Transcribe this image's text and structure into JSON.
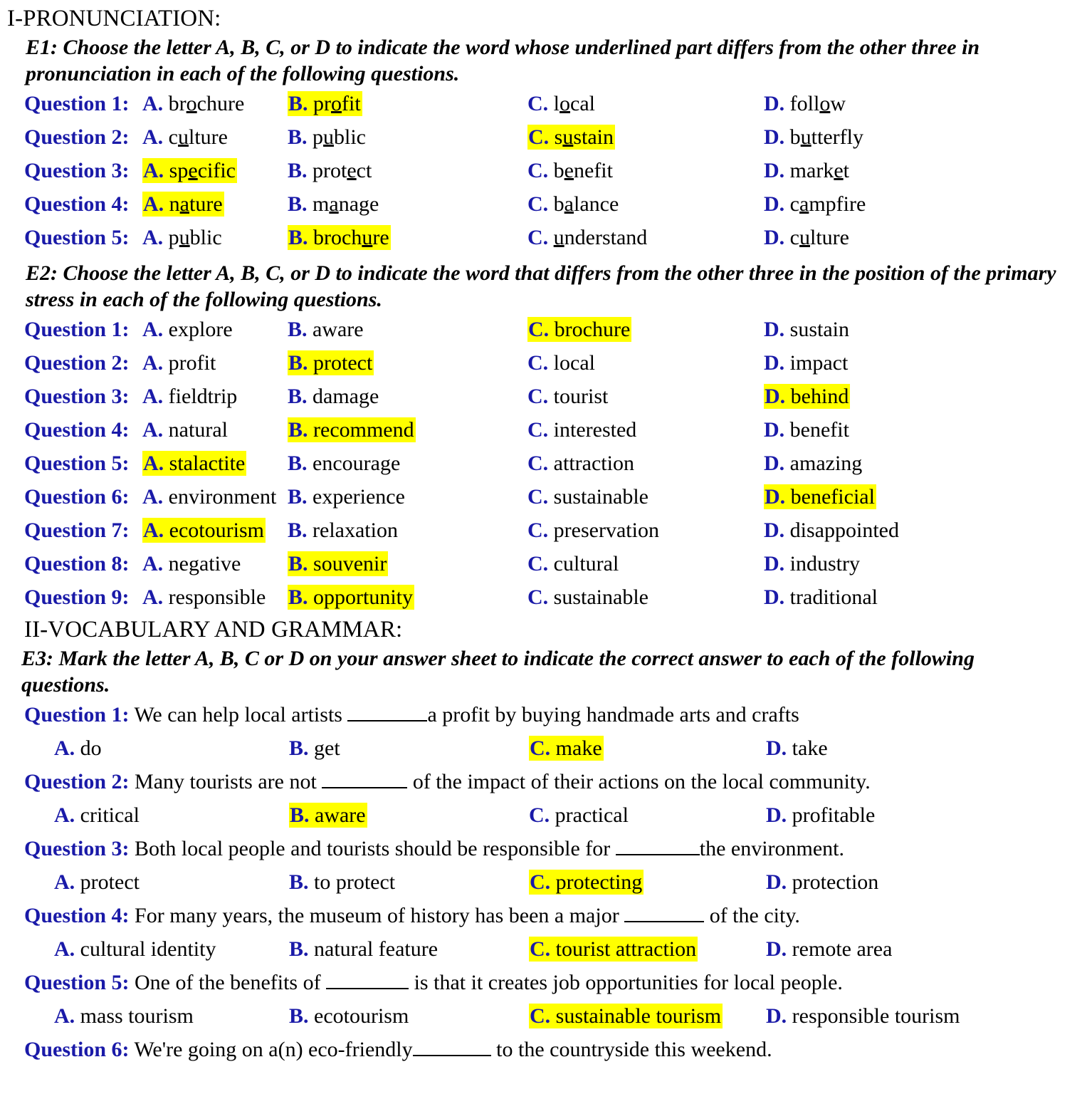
{
  "colors": {
    "blue": "#1a1aa8",
    "highlight": "#ffff00",
    "text": "#000000",
    "page_background": "#ffffff"
  },
  "sections": {
    "s1_heading": "I-PRONUNCIATION:",
    "s2_heading": "II-VOCABULARY AND GRAMMAR:"
  },
  "e1": {
    "instruction": "E1: Choose the letter A, B, C, or D to indicate the word whose underlined part differs from the other three in pronunciation in each of the following questions.",
    "questions": [
      {
        "label": "Question 1:",
        "options": [
          {
            "letter": "A.",
            "pre": "br",
            "mid": "o",
            "post": "chure",
            "highlight": false
          },
          {
            "letter": "B.",
            "pre": "pr",
            "mid": "o",
            "post": "fit",
            "highlight": true
          },
          {
            "letter": "C.",
            "pre": "l",
            "mid": "o",
            "post": "cal",
            "highlight": false
          },
          {
            "letter": "D.",
            "pre": "foll",
            "mid": "o",
            "post": "w",
            "highlight": false
          }
        ]
      },
      {
        "label": "Question 2:",
        "options": [
          {
            "letter": "A.",
            "pre": "c",
            "mid": "u",
            "post": "lture",
            "highlight": false
          },
          {
            "letter": "B.",
            "pre": "p",
            "mid": "u",
            "post": "blic",
            "highlight": false
          },
          {
            "letter": "C.",
            "pre": "s",
            "mid": "u",
            "post": "stain",
            "highlight": true
          },
          {
            "letter": "D.",
            "pre": "b",
            "mid": "u",
            "post": "tterfly",
            "highlight": false
          }
        ]
      },
      {
        "label": "Question 3:",
        "options": [
          {
            "letter": "A.",
            "pre": "sp",
            "mid": "e",
            "post": "cific",
            "highlight": true
          },
          {
            "letter": "B.",
            "pre": "prot",
            "mid": "e",
            "post": "ct",
            "highlight": false
          },
          {
            "letter": "C.",
            "pre": "b",
            "mid": "e",
            "post": "nefit",
            "highlight": false
          },
          {
            "letter": "D.",
            "pre": "mark",
            "mid": "e",
            "post": "t",
            "highlight": false
          }
        ]
      },
      {
        "label": "Question 4:",
        "options": [
          {
            "letter": "A.",
            "pre": "n",
            "mid": "a",
            "post": "ture",
            "highlight": true
          },
          {
            "letter": "B.",
            "pre": "m",
            "mid": "a",
            "post": "nage",
            "highlight": false
          },
          {
            "letter": "C.",
            "pre": "b",
            "mid": "a",
            "post": "lance",
            "highlight": false
          },
          {
            "letter": "D.",
            "pre": "c",
            "mid": "a",
            "post": "mpfire",
            "highlight": false
          }
        ]
      },
      {
        "label": "Question 5:",
        "options": [
          {
            "letter": "A.",
            "pre": "p",
            "mid": "u",
            "post": "blic",
            "highlight": false
          },
          {
            "letter": "B.",
            "pre": "broch",
            "mid": "u",
            "post": "re",
            "highlight": true
          },
          {
            "letter": "C.",
            "pre": "",
            "mid": "u",
            "post": "nderstand",
            "highlight": false
          },
          {
            "letter": "D.",
            "pre": "c",
            "mid": "u",
            "post": "lture",
            "highlight": false
          }
        ]
      }
    ]
  },
  "e2": {
    "instruction": "E2: Choose the letter A, B, C, or D to indicate the word that differs from the other three in the position of the primary stress in each of the following questions.",
    "questions": [
      {
        "label": "Question 1:",
        "options": [
          {
            "letter": "A.",
            "word": "explore",
            "highlight": false
          },
          {
            "letter": "B.",
            "word": "aware",
            "highlight": false
          },
          {
            "letter": "C.",
            "word": "brochure",
            "highlight": true
          },
          {
            "letter": "D.",
            "word": "sustain",
            "highlight": false
          }
        ]
      },
      {
        "label": "Question 2:",
        "options": [
          {
            "letter": "A.",
            "word": "profit",
            "highlight": false
          },
          {
            "letter": "B.",
            "word": "protect",
            "highlight": true
          },
          {
            "letter": "C.",
            "word": "local",
            "highlight": false
          },
          {
            "letter": "D.",
            "word": "impact",
            "highlight": false
          }
        ]
      },
      {
        "label": "Question 3:",
        "options": [
          {
            "letter": "A.",
            "word": "fieldtrip",
            "highlight": false
          },
          {
            "letter": "B.",
            "word": "damage",
            "highlight": false
          },
          {
            "letter": "C.",
            "word": "tourist",
            "highlight": false
          },
          {
            "letter": "D.",
            "word": "behind",
            "highlight": true
          }
        ]
      },
      {
        "label": "Question 4:",
        "options": [
          {
            "letter": "A.",
            "word": "natural",
            "highlight": false
          },
          {
            "letter": "B.",
            "word": "recommend",
            "highlight": true
          },
          {
            "letter": "C.",
            "word": "interested",
            "highlight": false
          },
          {
            "letter": "D.",
            "word": "benefit",
            "highlight": false
          }
        ]
      },
      {
        "label": "Question 5:",
        "options": [
          {
            "letter": "A.",
            "word": "stalactite",
            "highlight": true
          },
          {
            "letter": "B.",
            "word": "encourage",
            "highlight": false
          },
          {
            "letter": "C.",
            "word": "attraction",
            "highlight": false
          },
          {
            "letter": "D.",
            "word": "amazing",
            "highlight": false
          }
        ]
      },
      {
        "label": "Question 6:",
        "options": [
          {
            "letter": "A.",
            "word": "environment",
            "highlight": false
          },
          {
            "letter": "B.",
            "word": "experience",
            "highlight": false
          },
          {
            "letter": "C.",
            "word": "sustainable",
            "highlight": false
          },
          {
            "letter": "D.",
            "word": "beneficial",
            "highlight": true
          }
        ]
      },
      {
        "label": "Question 7:",
        "options": [
          {
            "letter": "A.",
            "word": "ecotourism",
            "highlight": true
          },
          {
            "letter": "B.",
            "word": "relaxation",
            "highlight": false
          },
          {
            "letter": "C.",
            "word": "preservation",
            "highlight": false
          },
          {
            "letter": "D.",
            "word": "disappointed",
            "highlight": false
          }
        ]
      },
      {
        "label": "Question 8:",
        "options": [
          {
            "letter": "A.",
            "word": "negative",
            "highlight": false
          },
          {
            "letter": "B.",
            "word": "souvenir",
            "highlight": true
          },
          {
            "letter": "C.",
            "word": "cultural",
            "highlight": false
          },
          {
            "letter": "D.",
            "word": "industry",
            "highlight": false
          }
        ]
      },
      {
        "label": "Question 9:",
        "options": [
          {
            "letter": "A.",
            "word": "responsible",
            "highlight": false
          },
          {
            "letter": "B.",
            "word": "opportunity",
            "highlight": true
          },
          {
            "letter": "C.",
            "word": "sustainable",
            "highlight": false
          },
          {
            "letter": "D.",
            "word": "traditional",
            "highlight": false
          }
        ]
      }
    ]
  },
  "e3": {
    "instruction": "E3: Mark the letter A, B, C or D on your answer sheet to indicate the correct answer to each of the following questions.",
    "questions": [
      {
        "label": "Question 1:",
        "stem_before": "We can help local artists",
        "stem_after": "a profit by buying handmade arts and crafts",
        "options": [
          {
            "letter": "A.",
            "text": "do",
            "highlight": false
          },
          {
            "letter": "B.",
            "text": "get",
            "highlight": false
          },
          {
            "letter": "C.",
            "text": "make",
            "highlight": true
          },
          {
            "letter": "D.",
            "text": "take",
            "highlight": false
          }
        ]
      },
      {
        "label": "Question 2:",
        "stem_before": "Many tourists are not",
        "stem_after": "of the impact of their actions on the local community.",
        "options": [
          {
            "letter": "A.",
            "text": "critical",
            "highlight": false
          },
          {
            "letter": "B.",
            "text": "aware",
            "highlight": true
          },
          {
            "letter": "C.",
            "text": "practical",
            "highlight": false
          },
          {
            "letter": "D.",
            "text": "profitable",
            "highlight": false
          }
        ]
      },
      {
        "label": "Question 3:",
        "stem_before": "Both local people and tourists should be responsible for",
        "stem_after": "the environment.",
        "options": [
          {
            "letter": "A.",
            "text": "protect",
            "highlight": false
          },
          {
            "letter": "B.",
            "text": "to protect",
            "highlight": false
          },
          {
            "letter": "C.",
            "text": "protecting",
            "highlight": true
          },
          {
            "letter": "D.",
            "text": "protection",
            "highlight": false
          }
        ]
      },
      {
        "label": "Question 4:",
        "stem_before": "For many years, the museum of history has been a major",
        "stem_after": "of the city.",
        "options": [
          {
            "letter": "A.",
            "text": "cultural identity",
            "highlight": false
          },
          {
            "letter": "B.",
            "text": "natural feature",
            "highlight": false
          },
          {
            "letter": "C.",
            "text": "tourist attraction",
            "highlight": true
          },
          {
            "letter": "D.",
            "text": "remote area",
            "highlight": false
          }
        ]
      },
      {
        "label": "Question 5:",
        "stem_before": "One of the benefits of",
        "stem_after": "is that it creates job opportunities for local people.",
        "options": [
          {
            "letter": "A.",
            "text": "mass tourism",
            "highlight": false
          },
          {
            "letter": "B.",
            "text": "ecotourism",
            "highlight": false
          },
          {
            "letter": "C.",
            "text": "sustainable tourism",
            "highlight": true
          },
          {
            "letter": "D.",
            "text": "responsible tourism",
            "highlight": false
          }
        ]
      },
      {
        "label": "Question 6:",
        "stem_before": "We're going on a(n) eco-friendly",
        "stem_after": "to the countryside this weekend.",
        "options": []
      }
    ]
  }
}
